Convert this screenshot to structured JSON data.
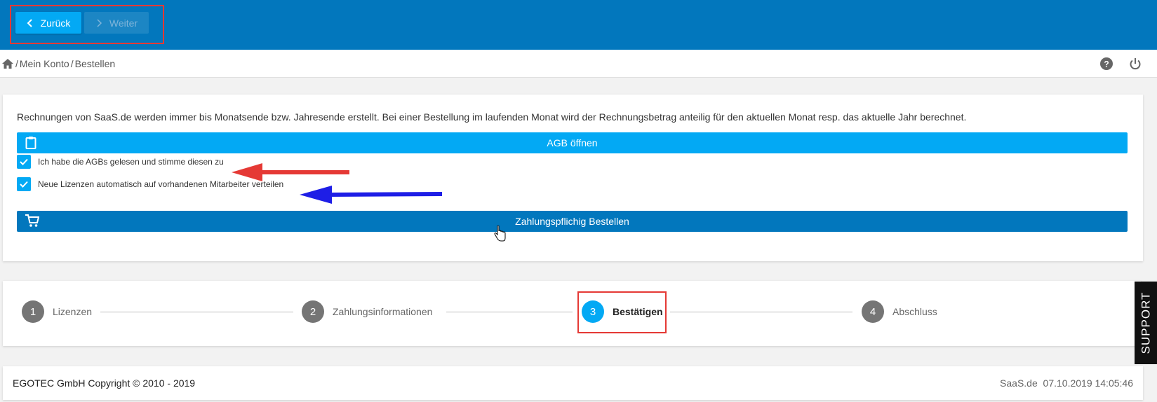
{
  "nav": {
    "back_label": "Zurück",
    "next_label": "Weiter"
  },
  "breadcrumb": {
    "sep1": "/",
    "item1": "Mein Konto",
    "sep2": "/",
    "item2": "Bestellen"
  },
  "card": {
    "info_text": "Rechnungen von SaaS.de werden immer bis Monatsende bzw. Jahresende erstellt. Bei einer Bestellung im laufenden Monat wird der Rechnungsbetrag anteilig für den aktuellen Monat resp. das aktuelle Jahr berechnet.",
    "agb_button": "AGB öffnen",
    "checkbox_agb": "Ich habe die AGBs gelesen und stimme diesen zu",
    "checkbox_licenses": "Neue Lizenzen automatisch auf vorhandenen Mitarbeiter verteilen",
    "order_button": "Zahlungspflichig Bestellen"
  },
  "steps": [
    {
      "num": "1",
      "label": "Lizenzen"
    },
    {
      "num": "2",
      "label": "Zahlungsinformationen"
    },
    {
      "num": "3",
      "label": "Bestätigen"
    },
    {
      "num": "4",
      "label": "Abschluss"
    }
  ],
  "support_label": "SUPPORT",
  "footer": {
    "copyright": "EGOTEC GmbH Copyright © 2010 - 2019",
    "brand": "SaaS.de",
    "datetime": "07.10.2019 14:05:46"
  },
  "colors": {
    "primary_dark": "#0277bd",
    "primary_light": "#03a9f4",
    "annotation_red": "#e53935",
    "annotation_blue": "#1e1ee6"
  }
}
